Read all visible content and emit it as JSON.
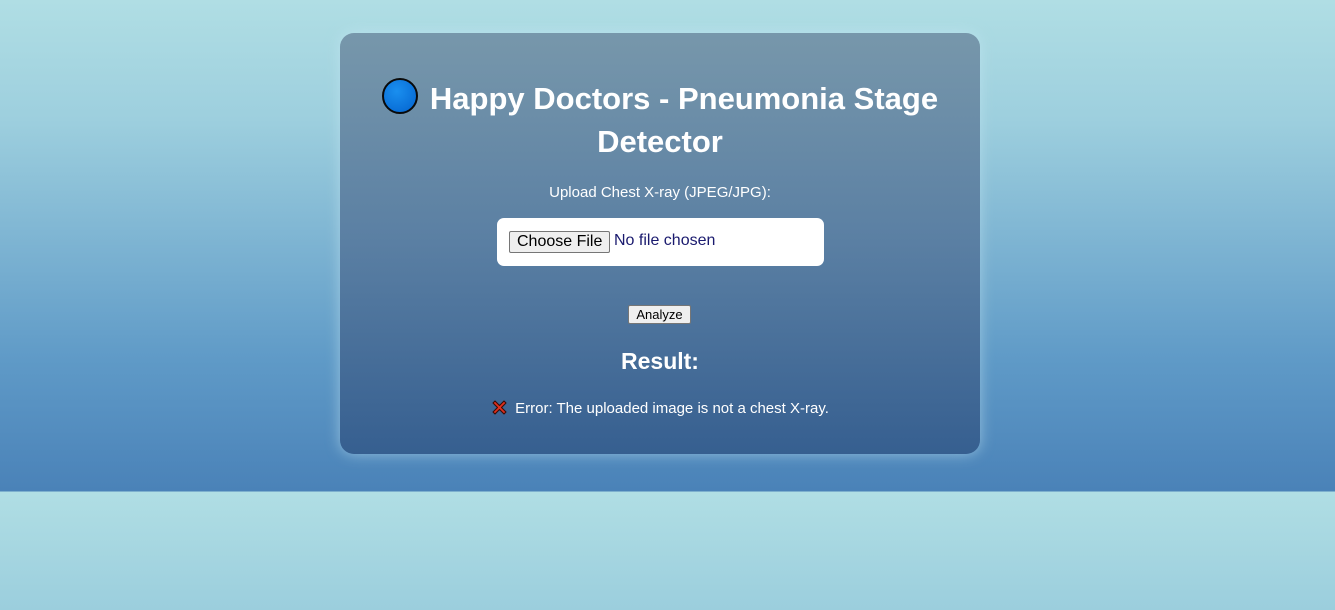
{
  "header": {
    "title": "Happy Doctors - Pneumonia Stage Detector",
    "icon": "blue-circle-icon"
  },
  "upload": {
    "label": "Upload Chest X-ray (JPEG/JPG):",
    "choose_button": "Choose File",
    "file_status": "No file chosen"
  },
  "actions": {
    "analyze_label": "Analyze"
  },
  "result": {
    "heading": "Result:",
    "icon": "cross-mark-icon",
    "message": "Error: The uploaded image is not a chest X-ray."
  },
  "colors": {
    "card_top": "#7797ab",
    "card_bottom": "#365f90",
    "icon_blue": "#0a70d8",
    "error_red": "#e0301e"
  }
}
